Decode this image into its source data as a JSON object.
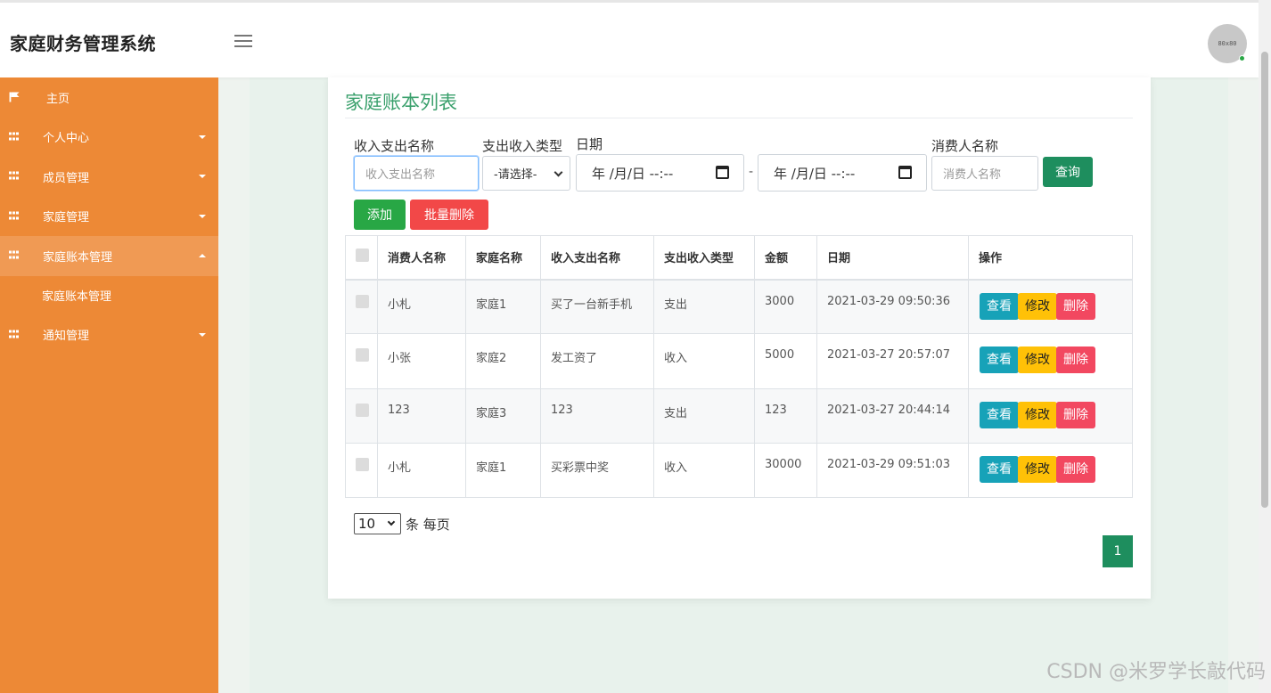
{
  "header": {
    "app_title": "家庭财务管理系统",
    "avatar_text": "80x80"
  },
  "sidebar": {
    "items": [
      {
        "label": "主页",
        "icon": "flag-icon"
      },
      {
        "label": "个人中心",
        "icon": "grid-icon"
      },
      {
        "label": "成员管理",
        "icon": "grid-icon"
      },
      {
        "label": "家庭管理",
        "icon": "grid-icon"
      },
      {
        "label": "家庭账本管理",
        "icon": "grid-icon",
        "expanded": true
      },
      {
        "label": "通知管理",
        "icon": "grid-icon"
      }
    ],
    "sub_item": "家庭账本管理"
  },
  "main": {
    "title": "家庭账本列表",
    "filters": {
      "name_label": "收入支出名称",
      "name_placeholder": "收入支出名称",
      "type_label": "支出收入类型",
      "type_value": "-请选择-",
      "date_label": "日期",
      "date_start": "年 /月/日 --:--",
      "date_end": "年 /月/日 --:--",
      "range_sep": "-",
      "consumer_label": "消费人名称",
      "consumer_placeholder": "消费人名称",
      "query_button": "查询"
    },
    "actions": {
      "add_button": "添加",
      "batch_delete_button": "批量删除"
    },
    "table": {
      "headers": [
        "消费人名称",
        "家庭名称",
        "收入支出名称",
        "支出收入类型",
        "金额",
        "日期",
        "操作"
      ],
      "rows": [
        {
          "consumer": "小札",
          "family": "家庭1",
          "name": "买了一台新手机",
          "type": "支出",
          "amount": "3000",
          "date": "2021-03-29 09:50:36"
        },
        {
          "consumer": "小张",
          "family": "家庭2",
          "name": "发工资了",
          "type": "收入",
          "amount": "5000",
          "date": "2021-03-27 20:57:07"
        },
        {
          "consumer": "123",
          "family": "家庭3",
          "name": "123",
          "type": "支出",
          "amount": "123",
          "date": "2021-03-27 20:44:14"
        },
        {
          "consumer": "小札",
          "family": "家庭1",
          "name": "买彩票中奖",
          "type": "收入",
          "amount": "30000",
          "date": "2021-03-29 09:51:03"
        }
      ],
      "row_actions": {
        "view": "查看",
        "edit": "修改",
        "delete": "删除"
      }
    },
    "pagination": {
      "page_size": "10",
      "page_size_label": "条 每页",
      "current_page": "1"
    }
  },
  "watermark": "CSDN @米罗学长敲代码",
  "colors": {
    "sidebar": "#ed8936",
    "title": "#3aa06c",
    "primary": "#1e8e5e",
    "add": "#28a745",
    "danger": "#f24848",
    "view": "#17a2b8",
    "edit": "#ffc107"
  }
}
